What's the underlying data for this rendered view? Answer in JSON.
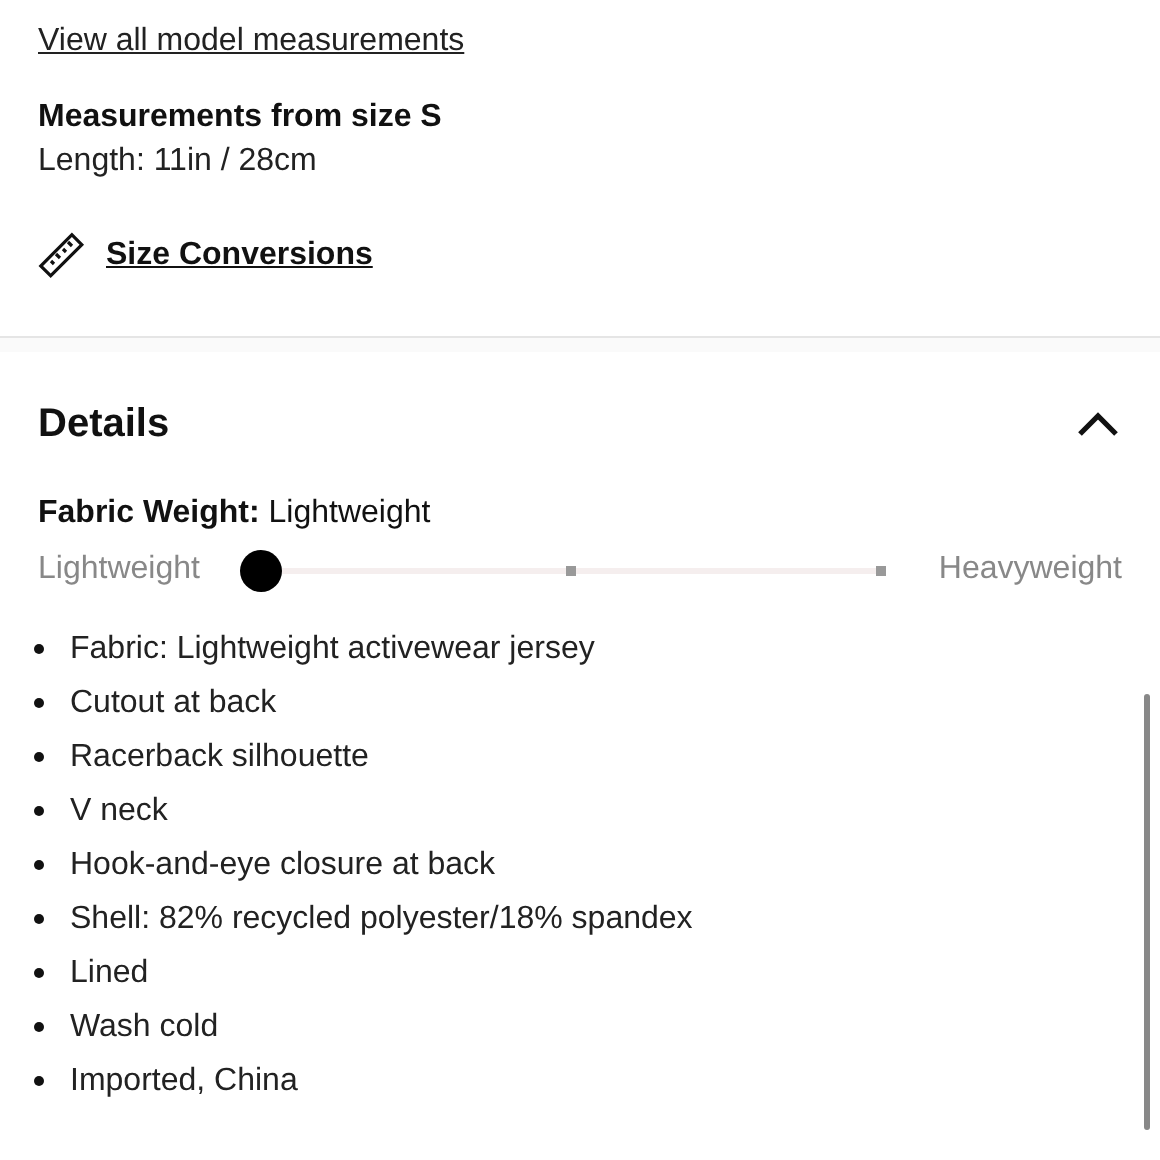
{
  "model_info": {
    "link": "View all model measurements"
  },
  "measurements": {
    "heading": "Measurements from size S",
    "length": "Length: 11in / 28cm"
  },
  "size_conversions": {
    "label": "Size Conversions"
  },
  "details": {
    "title": "Details",
    "expanded": true,
    "fabric_weight": {
      "label": "Fabric Weight:",
      "value": "Lightweight",
      "min_label": "Lightweight",
      "max_label": "Heavyweight",
      "level": 0
    },
    "bullets": [
      "Fabric: Lightweight activewear jersey",
      "Cutout at back",
      "Racerback silhouette",
      "V neck",
      "Hook-and-eye closure at back",
      "Shell: 82% recycled polyester/18% spandex",
      "Lined",
      "Wash cold",
      "Imported, China"
    ]
  }
}
